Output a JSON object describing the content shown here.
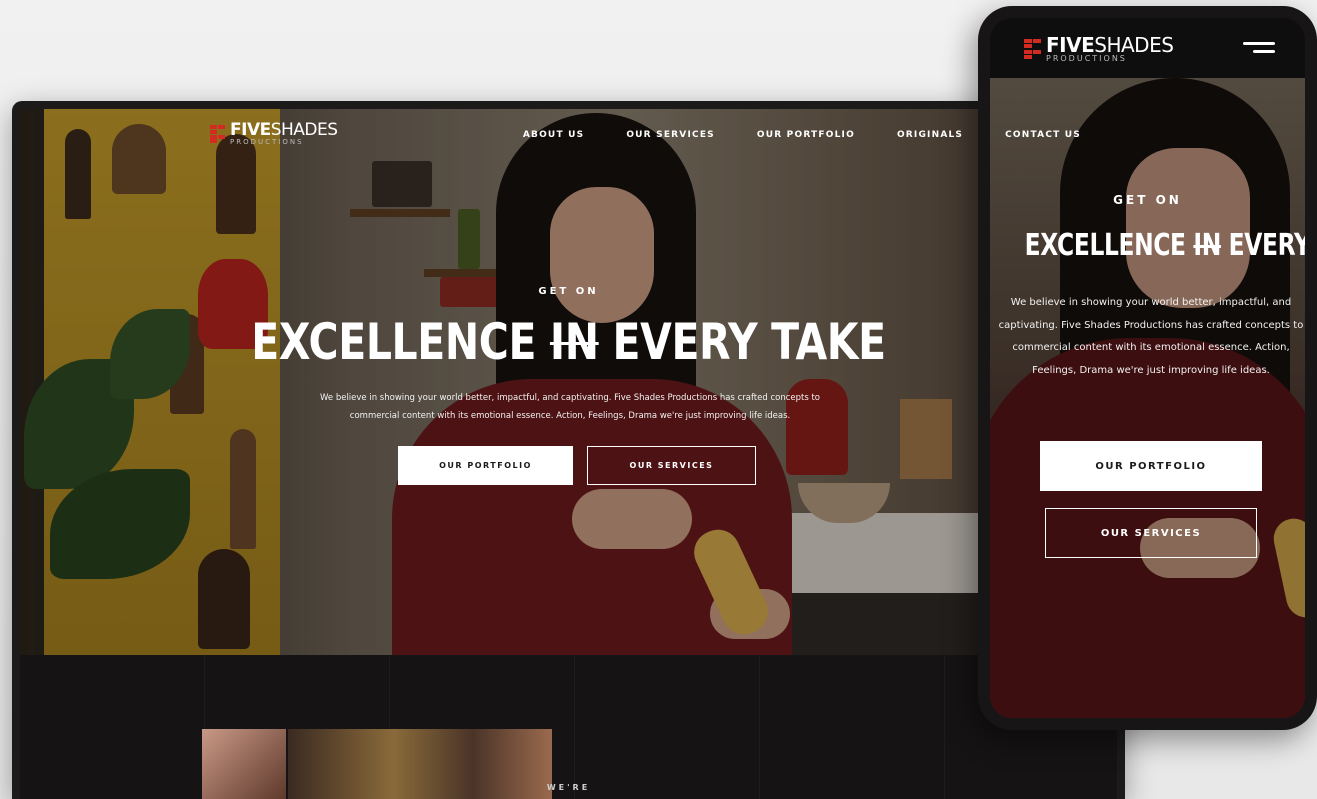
{
  "brand": {
    "name_bold": "FIVE",
    "name_light": "SHADES",
    "tagline": "PRODUCTIONS",
    "accent_color": "#d32b22"
  },
  "nav": {
    "items": [
      {
        "label": "ABOUT US"
      },
      {
        "label": "OUR SERVICES"
      },
      {
        "label": "OUR PORTFOLIO"
      },
      {
        "label": "ORIGINALS"
      },
      {
        "label": "CONTACT US"
      }
    ],
    "menu_icon": "hamburger-menu-icon"
  },
  "hero": {
    "eyebrow": "GET ON",
    "headline_part1": "EXCELLENCE ",
    "headline_strike": "IN",
    "headline_part2": " EVERY TAKE",
    "description": "We believe in showing your world better, impactful, and captivating. Five Shades Productions has crafted concepts to commercial content with its emotional essence. Action, Feelings, Drama we're just improving life ideas.",
    "primary_button": "OUR PORTFOLIO",
    "secondary_button": "OUR SERVICES"
  },
  "lower_section": {
    "label": "WE'RE"
  }
}
